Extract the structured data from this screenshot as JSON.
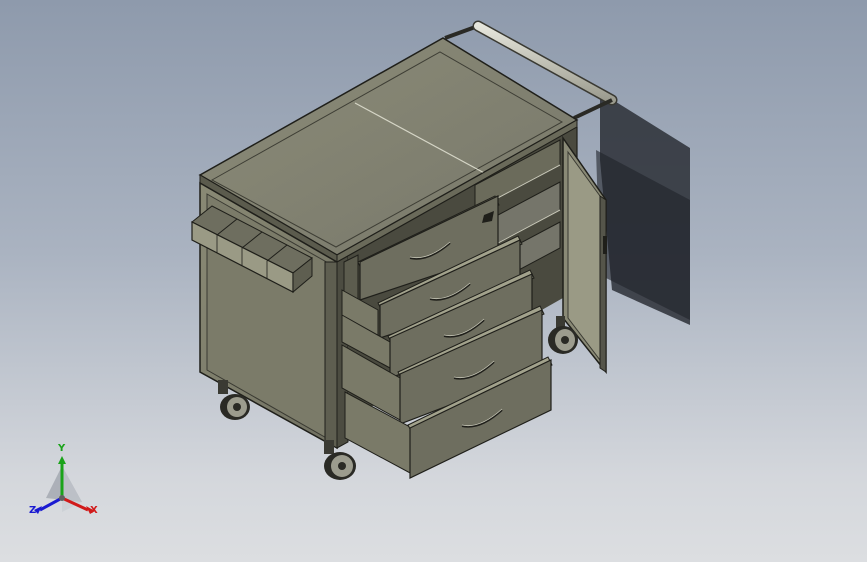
{
  "triad": {
    "y_label": "Y",
    "x_label": "X",
    "z_label": "Z"
  },
  "colors": {
    "background_top": "#8e9aac",
    "background_bottom": "#dcdee1",
    "body": "#82826e",
    "body_dark": "#5b5b4d",
    "edge": "#1f1f1a",
    "axis_x": "#d11a1a",
    "axis_y": "#1aa31a",
    "axis_z": "#1a1ad1"
  }
}
